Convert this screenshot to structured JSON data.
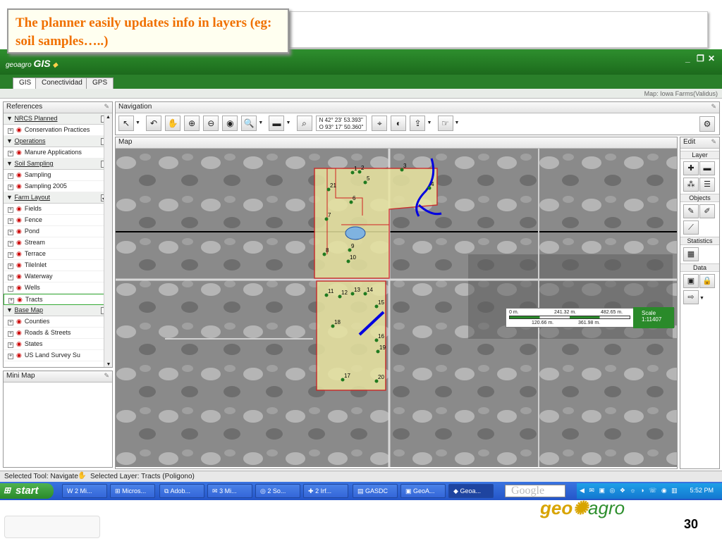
{
  "callout": {
    "text": "The planner easily updates info in layers (eg: soil samples…..)"
  },
  "app": {
    "logo_prefix": "geoagro",
    "logo_main": "GIS",
    "win_min": "_",
    "win_max": "❐",
    "win_close": "✕"
  },
  "tabs": [
    {
      "label": "GIS"
    },
    {
      "label": "Conectividad"
    },
    {
      "label": "GPS"
    }
  ],
  "map_name": "Map: Iowa Farms(Validus)",
  "references": {
    "title": "References",
    "groups": [
      {
        "label": "NRCS Planned",
        "items": [
          "Conservation Practices"
        ]
      },
      {
        "label": "Operations",
        "items": [
          "Manure Applications"
        ]
      },
      {
        "label": "Soil Sampling",
        "items": [
          "Sampling",
          "Sampling 2005"
        ]
      },
      {
        "label": "Farm Layout",
        "checked": "✔",
        "items": [
          "Fields",
          "Fence",
          "Pond",
          "Stream",
          "Terrace",
          "TileInlet",
          "Waterway",
          "Wells",
          "Tracts"
        ]
      },
      {
        "label": "Base Map",
        "items": [
          "Counties",
          "Roads & Streets",
          "States",
          "US Land Survey Su"
        ]
      }
    ]
  },
  "minimap": {
    "title": "Mini Map"
  },
  "navigation": {
    "title": "Navigation",
    "coord_lat": "N 42° 23' 53.393\"",
    "coord_lon": "O 93° 17' 50.360\""
  },
  "map": {
    "title": "Map",
    "labels": [
      "1",
      "2",
      "3",
      "4",
      "5",
      "6",
      "21",
      "7",
      "8",
      "9",
      "10",
      "11",
      "12",
      "13",
      "14",
      "15",
      "18",
      "16",
      "19",
      "17",
      "20"
    ],
    "scale": {
      "t1": "0 m.",
      "t2": "241.32 m.",
      "t3": "482.65 m.",
      "b1": "120.66 m.",
      "b2": "361.98 m.",
      "label": "Scale",
      "ratio": "1:11407"
    }
  },
  "edit": {
    "title": "Edit",
    "sections": [
      "Layer",
      "Objects",
      "Statistics",
      "Data"
    ]
  },
  "status": {
    "tool": "Selected Tool: Navigate",
    "layer": "Selected Layer: Tracts (Poligono)"
  },
  "taskbar": {
    "start": "start",
    "buttons": [
      "2 Mi...",
      "Micros...",
      "Adob...",
      "3 Mi...",
      "2 So...",
      "2 Irf...",
      "GASDC",
      "GeoA...",
      "Geoa..."
    ],
    "search": "Google",
    "time": "5:52 PM"
  },
  "footer": {
    "brand_a": "geo",
    "brand_b": "agro",
    "page": "30"
  }
}
